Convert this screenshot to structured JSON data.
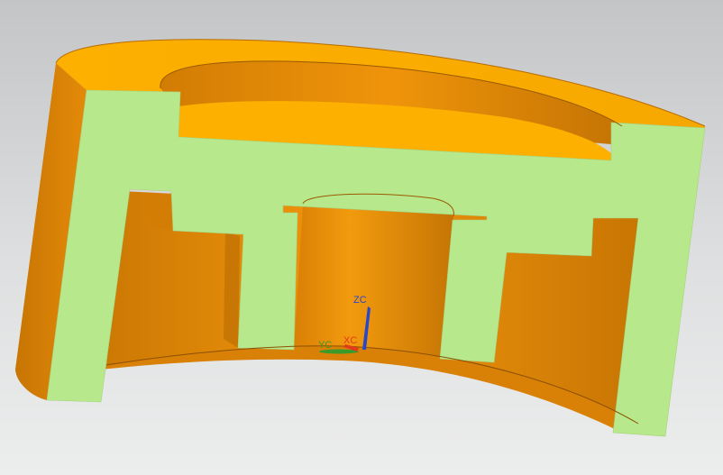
{
  "viewport": {
    "background_top": "#c3c5c7",
    "background_bottom": "#eceded"
  },
  "model": {
    "section_color": "#b8e88c",
    "body_color": "#e8900a",
    "top_face_color": "#fdb000",
    "shadow_color": "#c47404"
  },
  "triad": {
    "zc_label": "ZC",
    "yc_label": "YC",
    "xc_label": "XC",
    "zc_color": "#2a47c8",
    "yc_color": "#3a9a2a",
    "xc_color": "#e23a1a"
  }
}
